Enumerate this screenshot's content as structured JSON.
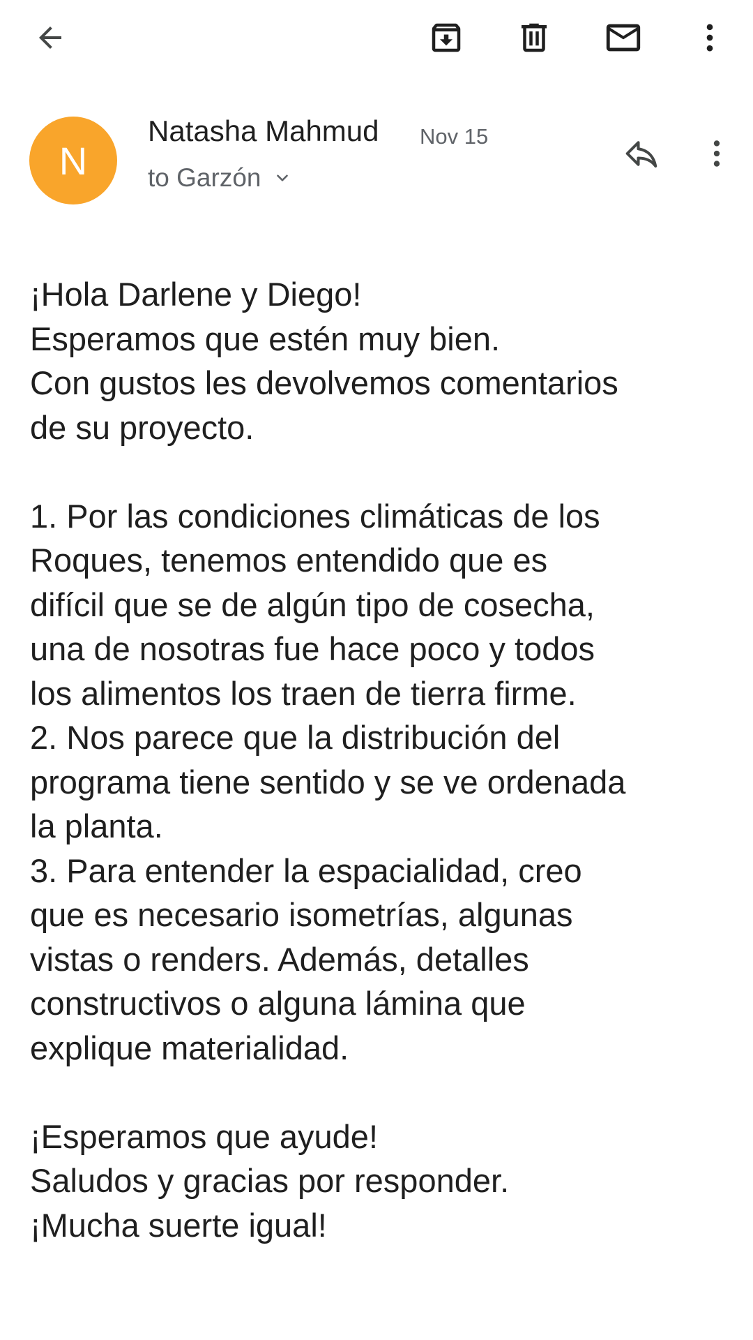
{
  "toolbar": {
    "back_icon": "arrow-back-icon",
    "archive_icon": "archive-icon",
    "delete_icon": "trash-icon",
    "mark_unread_icon": "mail-icon",
    "more_icon": "more-vert-icon"
  },
  "message": {
    "avatar_letter": "N",
    "avatar_color": "#f9a52b",
    "sender": "Natasha Mahmud",
    "date": "Nov 15",
    "recipient": "to Garzón",
    "reply_icon": "reply-icon",
    "more_icon": "more-vert-icon",
    "body_paragraphs": [
      [
        "¡Hola Darlene y Diego!",
        "Esperamos que estén muy bien.",
        "Con gustos les devolvemos comentarios",
        "de su proyecto."
      ],
      [
        "1. Por las condiciones climáticas de los",
        "Roques, tenemos entendido que es",
        "difícil que se de algún tipo de cosecha,",
        "una de nosotras fue hace poco y todos",
        "los alimentos los traen de tierra firme.",
        "2. Nos parece que la distribución del",
        "programa tiene sentido y se ve ordenada",
        "la planta.",
        "3. Para entender la espacialidad, creo",
        "que es necesario isometrías, algunas",
        "vistas o renders. Además, detalles",
        "constructivos o alguna lámina que",
        "explique materialidad."
      ],
      [
        "¡Esperamos que ayude!",
        "Saludos y gracias por responder.",
        "¡Mucha suerte igual!"
      ]
    ]
  }
}
